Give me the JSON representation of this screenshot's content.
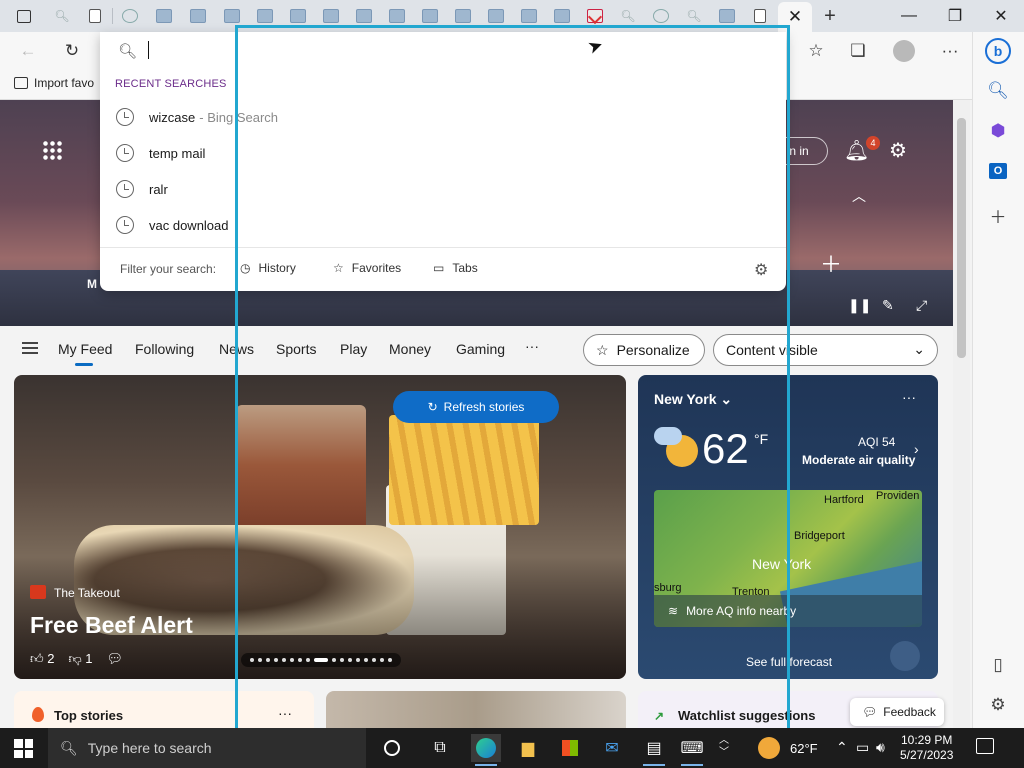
{
  "browser": {
    "new_tab_label": "+",
    "active_tab_close": "✕",
    "window_buttons": {
      "minimize": "—",
      "maximize": "❐",
      "close": "✕"
    },
    "favorites_bar": {
      "import_label": "Import favo"
    }
  },
  "search_dropdown": {
    "input_value": "",
    "recent_header": "RECENT SEARCHES",
    "recent": [
      {
        "term": "wizcase",
        "suffix": "- Bing Search"
      },
      {
        "term": "temp mail",
        "suffix": ""
      },
      {
        "term": "ralr",
        "suffix": ""
      },
      {
        "term": "vac download",
        "suffix": ""
      }
    ],
    "filter_label": "Filter your search:",
    "filters": [
      "History",
      "Favorites",
      "Tabs"
    ]
  },
  "hero": {
    "signin_label": "n in",
    "notification_count": "4",
    "partial_label": "M"
  },
  "nav": {
    "items": [
      "My Feed",
      "Following",
      "News",
      "Sports",
      "Play",
      "Money",
      "Gaming"
    ],
    "more": "···",
    "personalize": "Personalize",
    "content_visibility": "Content visible"
  },
  "main_card": {
    "refresh_label": "Refresh stories",
    "source": "The Takeout",
    "headline": "Free Beef Alert",
    "likes": "2",
    "dislikes": "1",
    "carousel_count": 17,
    "carousel_active": 8
  },
  "weather": {
    "city": "New York",
    "temperature": "62",
    "unit": "°F",
    "aqi": "AQI 54",
    "aqi_desc": "Moderate air quality",
    "map_labels": [
      "Hartford",
      "Providen",
      "Bridgeport",
      "New York",
      "sburg",
      "Trenton"
    ],
    "aq_info": "More AQ info nearby",
    "forecast_label": "See full forecast"
  },
  "bottom_cards": {
    "top_stories": "Top stories",
    "top_stories_more": "···",
    "watchlist": "Watchlist suggestions",
    "feedback": "Feedback"
  },
  "taskbar": {
    "search_placeholder": "Type here to search",
    "temperature": "62°F",
    "time": "10:29 PM",
    "date": "5/27/2023"
  }
}
